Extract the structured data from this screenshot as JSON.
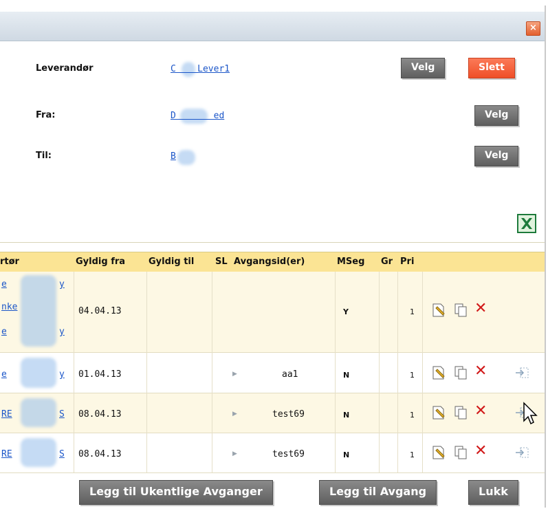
{
  "dialog": {
    "close_glyph": "×"
  },
  "form": {
    "leverandor": {
      "label": "Leverandør",
      "value": "C    Lever1",
      "velg": "Velg",
      "slett": "Slett"
    },
    "fra": {
      "label": "Fra:",
      "value": "D       ed",
      "velg": "Velg"
    },
    "til": {
      "label": "Til:",
      "value": "B",
      "velg": "Velg"
    }
  },
  "export_icon": "excel-export-icon",
  "table": {
    "headers": [
      "rtør",
      "Gyldig fra",
      "Gyldig til",
      "SL",
      "Avgangsid(er)",
      "MSeg",
      "Gr",
      "Pri"
    ],
    "rows": [
      {
        "operator": [
          "e",
          "nke",
          "e"
        ],
        "operator_suffix": [
          "y",
          "",
          "y"
        ],
        "gyldig_fra": "04.04.13",
        "gyldig_til": "",
        "avgang": "",
        "mseg": "Y",
        "gr": "",
        "pri": "1"
      },
      {
        "operator": [
          "e"
        ],
        "operator_suffix": [
          "y"
        ],
        "gyldig_fra": "01.04.13",
        "gyldig_til": "",
        "avgang": "aa1",
        "mseg": "N",
        "gr": "",
        "pri": "1"
      },
      {
        "operator": [
          "RE"
        ],
        "operator_suffix": [
          "S"
        ],
        "gyldig_fra": "08.04.13",
        "gyldig_til": "",
        "avgang": "test69",
        "mseg": "N",
        "gr": "",
        "pri": "1"
      },
      {
        "operator": [
          "RE"
        ],
        "operator_suffix": [
          "S"
        ],
        "gyldig_fra": "08.04.13",
        "gyldig_til": "",
        "avgang": "test69",
        "mseg": "N",
        "gr": "",
        "pri": "1"
      }
    ]
  },
  "buttons": {
    "ukentlige": "Legg til Ukentlige Avganger",
    "avgang": "Legg til Avgang",
    "lukk": "Lukk"
  },
  "colors": {
    "accent_red": "#ef4f28",
    "header_yellow": "#fbe494",
    "row_highlight": "#fdf8e4",
    "link_blue": "#1a55c8"
  }
}
